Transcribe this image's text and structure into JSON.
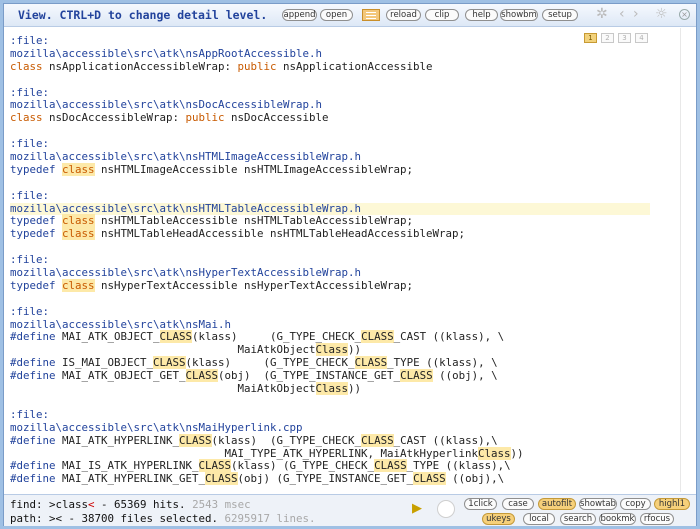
{
  "header": {
    "title": "View. CTRL+D to change detail level.",
    "buttons": [
      "append",
      "open",
      "reload",
      "clip",
      "help",
      "showbm",
      "setup"
    ]
  },
  "page_tabs": [
    "1",
    "2",
    "3",
    "4"
  ],
  "blocks": [
    {
      "file_label": ":file:",
      "path": "mozilla\\accessible\\src\\atk\\nsAppRootAccessible.h",
      "lines": [
        [
          "class",
          " nsApplicationAccessibleWrap: ",
          "public",
          " nsApplicationAccessible"
        ]
      ]
    },
    {
      "file_label": ":file:",
      "path": "mozilla\\accessible\\src\\atk\\nsDocAccessibleWrap.h",
      "lines": [
        [
          "class",
          " nsDocAccessibleWrap: ",
          "public",
          " nsDocAccessible"
        ]
      ]
    },
    {
      "file_label": ":file:",
      "path": "mozilla\\accessible\\src\\atk\\nsHTMLImageAccessibleWrap.h",
      "lines": [
        [
          "typedef ",
          "class",
          " nsHTMLImageAccessible nsHTMLImageAccessibleWrap;"
        ]
      ]
    },
    {
      "file_label": ":file:",
      "path": "mozilla\\accessible\\src\\atk\\nsHTMLTableAccessibleWrap.h",
      "lines": [
        [
          "typedef ",
          "class",
          " nsHTMLTableAccessible nsHTMLTableAccessibleWrap;"
        ],
        [
          "typedef ",
          "class",
          " nsHTMLTableHeadAccessible nsHTMLTableHeadAccessibleWrap;"
        ]
      ]
    },
    {
      "file_label": ":file:",
      "path": "mozilla\\accessible\\src\\atk\\nsHyperTextAccessibleWrap.h",
      "lines": [
        [
          "typedef ",
          "class",
          " nsHyperTextAccessible nsHyperTextAccessibleWrap;"
        ]
      ]
    },
    {
      "file_label": ":file:",
      "path": "mozilla\\accessible\\src\\atk\\nsMai.h",
      "lines": [
        [
          "#define",
          " MAI_ATK_OBJECT_",
          "CLASS",
          "(klass)     (G_TYPE_CHECK_",
          "CLASS",
          "_CAST ((klass), \\"
        ],
        [
          "",
          "                                   MaiAtkObject",
          "Class",
          "))"
        ],
        [
          "#define",
          " IS_MAI_OBJECT_",
          "CLASS",
          "(klass)     (G_TYPE_CHECK_",
          "CLASS",
          "_TYPE ((klass), \\"
        ],
        [
          "#define",
          " MAI_ATK_OBJECT_GET_",
          "CLASS",
          "(obj)  (G_TYPE_INSTANCE_GET_",
          "CLASS",
          " ((obj), \\"
        ],
        [
          "",
          "                                   MaiAtkObject",
          "Class",
          "))"
        ]
      ]
    },
    {
      "file_label": ":file:",
      "path": "mozilla\\accessible\\src\\atk\\nsMaiHyperlink.cpp",
      "lines": [
        [
          "#define",
          " MAI_ATK_HYPERLINK_",
          "CLASS",
          "(klass)  (G_TYPE_CHECK_",
          "CLASS",
          "_CAST ((klass),\\"
        ],
        [
          "",
          "                                 MAI_TYPE_ATK_HYPERLINK, MaiAtkHyperlink",
          "Class",
          "))"
        ],
        [
          "#define",
          " MAI_IS_ATK_HYPERLINK_",
          "CLASS",
          "(klass) (G_TYPE_CHECK_",
          "CLASS",
          "_TYPE ((klass),\\"
        ],
        [
          "#define",
          " MAI_ATK_HYPERLINK_GET_",
          "CLASS",
          "(obj) (G_TYPE_INSTANCE_GET_",
          "CLASS",
          " ((obj),\\"
        ]
      ]
    }
  ],
  "status": {
    "find_prefix": "find: >",
    "find_term": "class",
    "find_cursor": "<",
    "find_result": " - 65369 hits.",
    "find_time": " 2543 msec",
    "path_line": "path: >< - 38700 files selected.",
    "path_lines": " 6295917 lines."
  },
  "bottom_buttons_row1": [
    "1click",
    "case",
    "autofilt",
    "showtab",
    "copy",
    "highl1"
  ],
  "bottom_buttons_row2": [
    "ukeys",
    "local",
    "search",
    "bookmk",
    "rfocus"
  ],
  "colors": {
    "accent": "#22439c",
    "keyword": "#c85a00",
    "match_bg": "#fde9a8",
    "button_on": "#f6d07a"
  }
}
